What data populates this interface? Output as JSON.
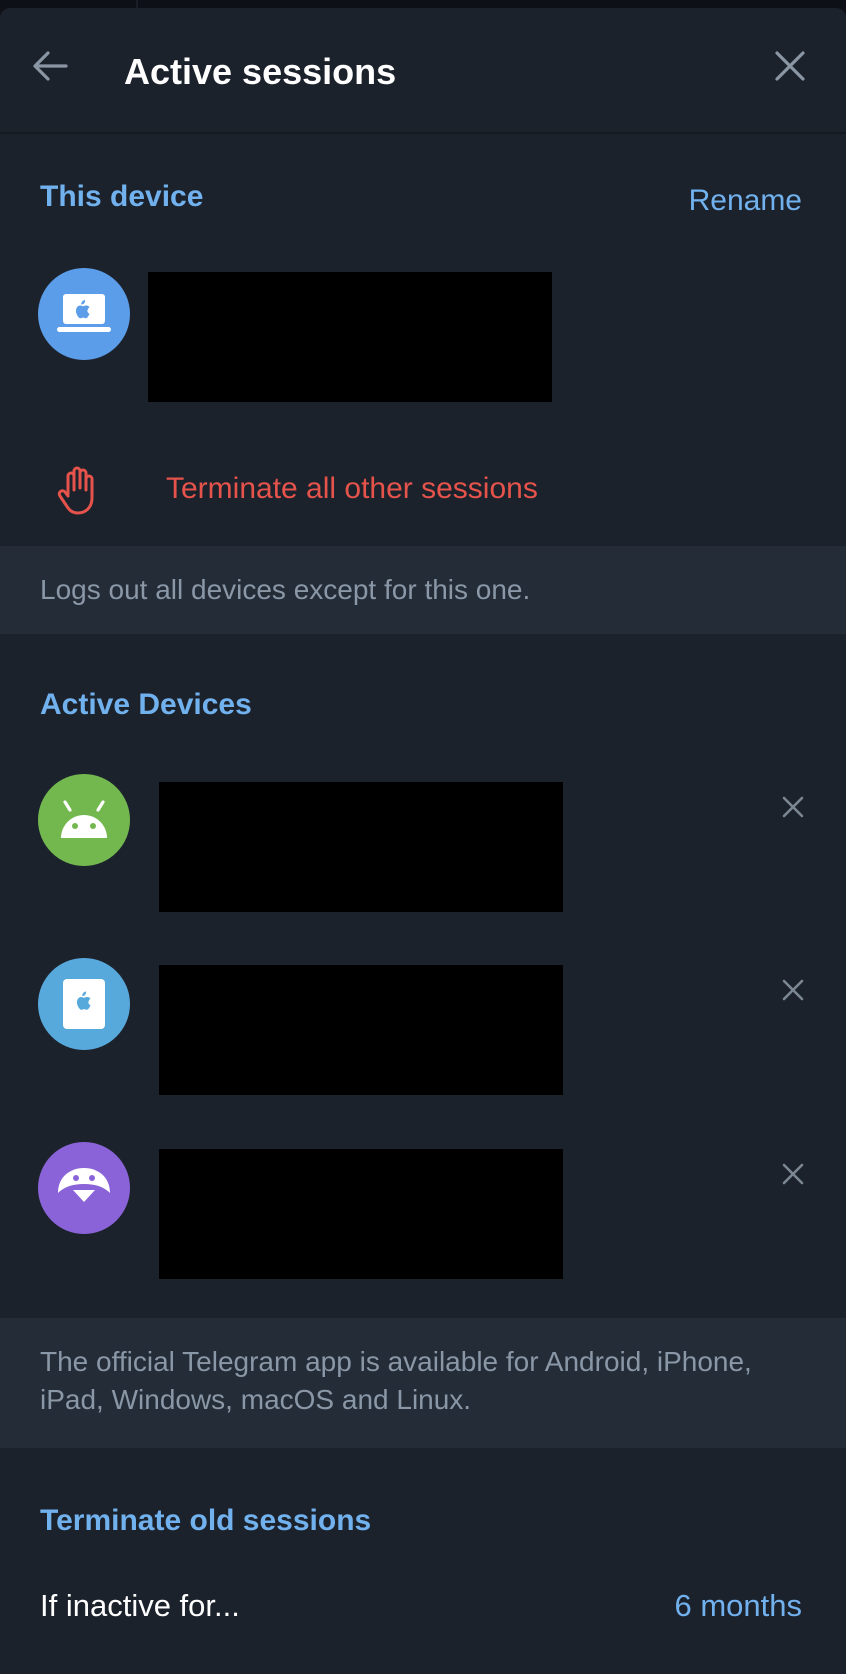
{
  "header": {
    "title": "Active sessions",
    "back_icon": "arrow-left-icon",
    "close_icon": "close-icon"
  },
  "this_device": {
    "section_title": "This device",
    "rename_label": "Rename",
    "device_icon": "macbook-icon",
    "icon_color": "#5b9de8"
  },
  "terminate": {
    "label": "Terminate all other sessions",
    "icon": "hand-stop-icon",
    "color": "#e5534b"
  },
  "terminate_info": "Logs out all devices except for this one.",
  "active_devices": {
    "section_title": "Active Devices",
    "items": [
      {
        "icon": "android-icon",
        "color": "#73b84f"
      },
      {
        "icon": "ipad-apple-icon",
        "color": "#57a9dc"
      },
      {
        "icon": "linux-penguin-icon",
        "color": "#8b63d8"
      }
    ]
  },
  "apps_info": "The official Telegram app is available for Android, iPhone, iPad, Windows, macOS and Linux.",
  "old_sessions": {
    "section_title": "Terminate old sessions",
    "label": "If inactive for...",
    "value": "6 months"
  }
}
